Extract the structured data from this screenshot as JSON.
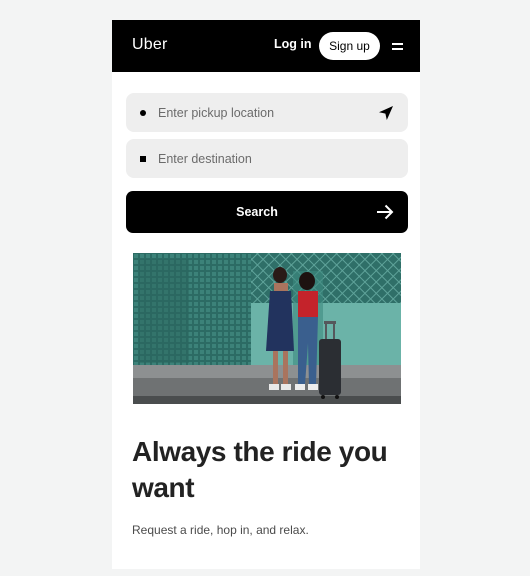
{
  "header": {
    "logo": "Uber",
    "login_label": "Log in",
    "signup_label": "Sign up",
    "menu_icon": "hamburger-menu-icon"
  },
  "form": {
    "pickup": {
      "placeholder": "Enter pickup location",
      "value": "",
      "icon": "location-arrow-icon"
    },
    "destination": {
      "placeholder": "Enter destination",
      "value": ""
    },
    "search_label": "Search",
    "search_icon": "arrow-right-icon"
  },
  "hero": {
    "title": "Always the ride you want",
    "subtitle": "Request a ride, hop in, and relax."
  },
  "colors": {
    "brand": "#000000",
    "field_bg": "#eeeeee",
    "page_bg": "#f3f4f4"
  }
}
